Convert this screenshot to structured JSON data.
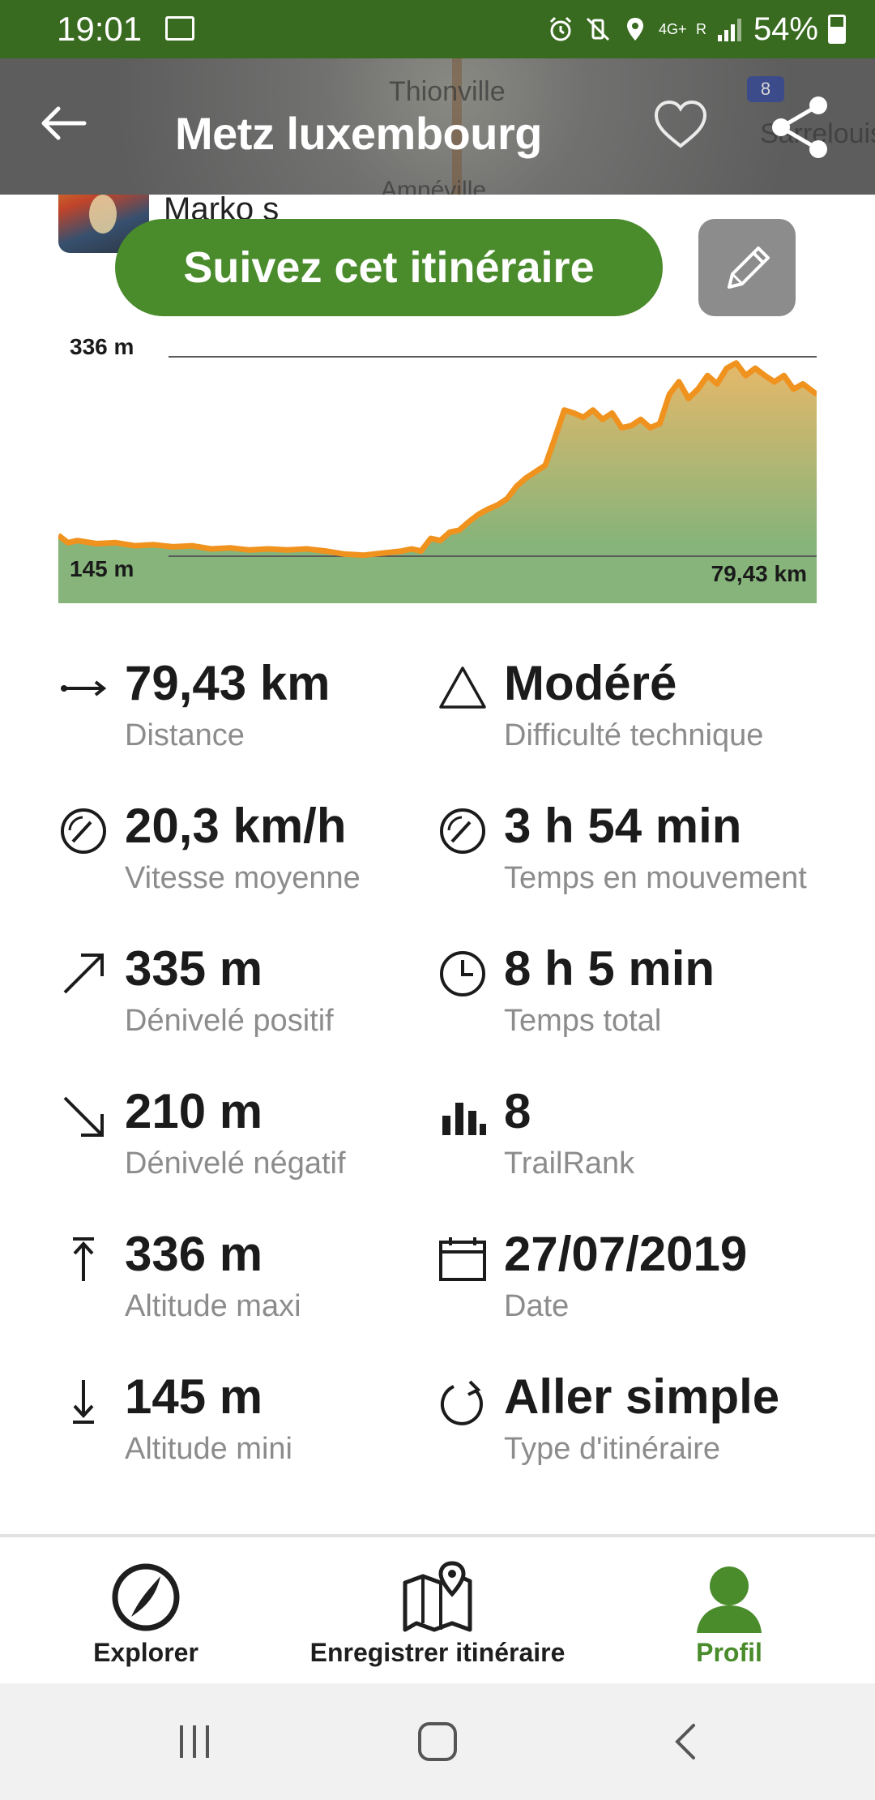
{
  "status_bar": {
    "time": "19:01",
    "network": "4G+",
    "roaming": "R",
    "battery": "54%"
  },
  "header": {
    "title": "Metz luxembourg",
    "map_labels": [
      "Thionville",
      "Amnéville",
      "Sarrelouis"
    ],
    "map_road_shield": "8"
  },
  "author": {
    "name": "Marko s"
  },
  "actions": {
    "follow_label": "Suivez cet itinéraire"
  },
  "chart_data": {
    "type": "area",
    "title": "",
    "xlabel": "",
    "ylabel": "",
    "ymax_label": "336 m",
    "ymin_label": "145 m",
    "xmax_label": "79,43 km",
    "xlim": [
      0,
      79.43
    ],
    "ylim": [
      145,
      336
    ],
    "x": [
      0,
      1,
      2,
      4,
      6,
      8,
      10,
      12,
      14,
      16,
      18,
      20,
      22,
      24,
      26,
      28,
      30,
      32,
      34,
      36,
      37,
      38,
      39,
      40,
      41,
      42,
      43,
      44,
      45,
      46,
      47,
      48,
      49,
      50,
      51,
      52,
      53,
      54,
      55,
      56,
      57,
      58,
      59,
      60,
      61,
      62,
      63,
      64,
      65,
      66,
      67,
      68,
      69,
      70,
      71,
      72,
      73,
      74,
      75,
      76,
      77,
      78,
      79.43
    ],
    "y": [
      165,
      158,
      160,
      157,
      158,
      155,
      156,
      154,
      155,
      152,
      153,
      151,
      152,
      151,
      152,
      150,
      147,
      146,
      148,
      150,
      152,
      150,
      162,
      160,
      168,
      170,
      178,
      185,
      190,
      194,
      200,
      212,
      220,
      226,
      232,
      258,
      285,
      282,
      278,
      285,
      276,
      282,
      268,
      270,
      276,
      268,
      272,
      300,
      312,
      296,
      305,
      318,
      310,
      325,
      330,
      318,
      325,
      318,
      312,
      318,
      305,
      310,
      300
    ],
    "line_color": "#f0921e",
    "fill_top_color": "#e6b86a",
    "fill_bottom_color": "#86b47a"
  },
  "stats": [
    {
      "icon": "distance-arrow-icon",
      "value": "79,43 km",
      "label": "Distance"
    },
    {
      "icon": "triangle-icon",
      "value": "Modéré",
      "label": "Difficulté technique"
    },
    {
      "icon": "speedometer-icon",
      "value": "20,3 km/h",
      "label": "Vitesse moyenne"
    },
    {
      "icon": "speedometer-icon",
      "value": "3 h 54 min",
      "label": "Temps en mouvement"
    },
    {
      "icon": "arrow-up-right-icon",
      "value": "335 m",
      "label": "Dénivelé positif"
    },
    {
      "icon": "clock-icon",
      "value": "8 h 5 min",
      "label": "Temps total"
    },
    {
      "icon": "arrow-down-right-icon",
      "value": "210 m",
      "label": "Dénivelé négatif"
    },
    {
      "icon": "bar-chart-icon",
      "value": "8",
      "label": "TrailRank"
    },
    {
      "icon": "altitude-max-icon",
      "value": "336 m",
      "label": "Altitude maxi"
    },
    {
      "icon": "calendar-icon",
      "value": "27/07/2019",
      "label": "Date"
    },
    {
      "icon": "altitude-min-icon",
      "value": "145 m",
      "label": "Altitude mini"
    },
    {
      "icon": "loop-arrow-icon",
      "value": "Aller simple",
      "label": "Type d'itinéraire"
    }
  ],
  "bottom_nav": {
    "explorer": "Explorer",
    "record": "Enregistrer itinéraire",
    "profile": "Profil",
    "active_color": "#4a8b2b"
  }
}
